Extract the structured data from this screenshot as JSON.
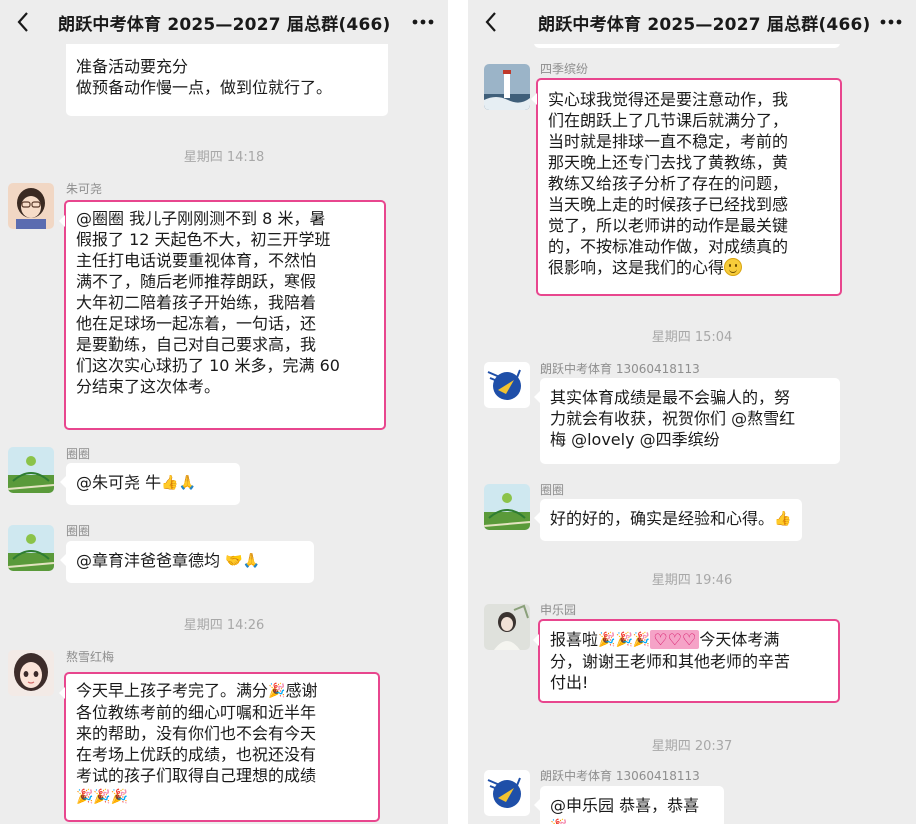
{
  "left": {
    "title": "朗跃中考体育 2025—2027 届总群(466)",
    "top_message": {
      "lines": [
        "准备活动要充分",
        "做预备动作慢一点，做到位就行了。"
      ]
    },
    "ts1": "星期四 14:18",
    "msg_zhu": {
      "sender": "朱可尧",
      "lines": [
        "@圈圈 我儿子刚刚测不到 8 米，暑",
        "假报了 12 天起色不大，初三开学班",
        "主任打电话说要重视体育，不然怕",
        "满不了，随后老师推荐朗跃，寒假",
        "大年初二陪着孩子开始练，我陪着",
        "他在足球场一起冻着，一句话，还",
        "是要勤练，自己对自己要求高，我",
        "们这次实心球扔了 10 米多，完满 60",
        "分结束了这次体考。"
      ]
    },
    "msg_quan1": {
      "sender": "圈圈",
      "text": "@朱可尧 牛",
      "emoji": "👍🙏"
    },
    "msg_quan2": {
      "sender": "圈圈",
      "text": "@章育沣爸爸章德均",
      "emoji": "🤝🙏"
    },
    "ts2": "星期四 14:26",
    "msg_xue": {
      "sender": "熬雪红梅",
      "line1": "今天早上孩子考完了。满分",
      "line1_emoji": "🎉",
      "line1_tail": "感谢",
      "lines": [
        "各位教练考前的细心叮嘱和近半年",
        "来的帮助，没有你们也不会有今天",
        "在考场上优跃的成绩，也祝还没有",
        "考试的孩子们取得自己理想的成绩"
      ],
      "last_emoji": "🎉🎉🎉"
    }
  },
  "right": {
    "title": "朗跃中考体育 2025—2027 届总群(466)",
    "msg_siji": {
      "sender": "四季缤纷",
      "lines": [
        "实心球我觉得还是要注意动作，我",
        "们在朗跃上了几节课后就满分了，",
        "当时就是排球一直不稳定，考前的",
        "那天晚上还专门去找了黄教练，黄",
        "教练又给孩子分析了存在的问题，",
        "当天晚上走的时候孩子已经找到感",
        "觉了，所以老师讲的动作是最关键",
        "的，不按标准动作做，对成绩真的"
      ],
      "last_line": "很影响，这是我们的心得"
    },
    "ts3": "星期四 15:04",
    "msg_ly1": {
      "sender": "朗跃中考体育 13060418113",
      "lines": [
        "其实体育成绩是最不会骗人的，努",
        "力就会有收获，祝贺你们 @熬雪红",
        "梅 @lovely @四季缤纷"
      ]
    },
    "msg_quan3": {
      "sender": "圈圈",
      "text": "好的好的，确实是经验和心得。",
      "emoji": "👍"
    },
    "ts4": "星期四 19:46",
    "msg_shen": {
      "sender": "申乐园",
      "line1_pre": "报喜啦",
      "line1_emoji": "🎉🎉🎉",
      "line1_hl": "♡♡♡",
      "line1_post": "今天体考满",
      "lines": [
        "分，谢谢王老师和其他老师的辛苦",
        "付出!"
      ]
    },
    "ts5": "星期四 20:37",
    "msg_ly2": {
      "sender": "朗跃中考体育 13060418113",
      "text": "@申乐园 恭喜，恭喜",
      "emoji": "🎉"
    }
  },
  "icons": [
    "back-icon",
    "more-icon",
    "smile-emoji-icon"
  ],
  "colors": {
    "background": "#ededed",
    "bubble": "#ffffff",
    "highlight_border": "#e8468e",
    "timestamp": "#a8a8a8"
  }
}
